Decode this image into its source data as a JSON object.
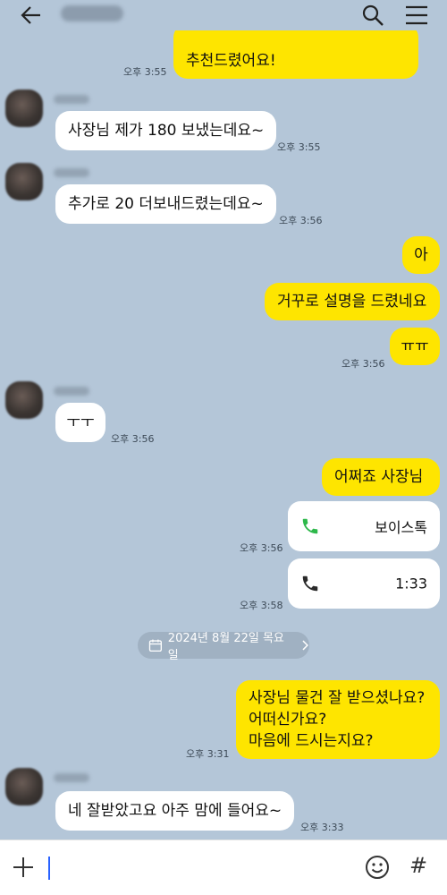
{
  "header": {
    "icons": [
      "back-arrow-icon",
      "search-icon",
      "hamburger-menu-icon"
    ]
  },
  "messages": [
    {
      "id": "m0",
      "dir": "out",
      "text": "추천드렸어요!",
      "time": "오후 3:55"
    },
    {
      "id": "m1",
      "dir": "in",
      "text": "사장님 제가 180 보냈는데요~",
      "time": "오후 3:55"
    },
    {
      "id": "m2",
      "dir": "in",
      "text": "추가로 20 더보내드렸는데요~",
      "time": "오후 3:56"
    },
    {
      "id": "m3",
      "dir": "out",
      "text": "아"
    },
    {
      "id": "m4",
      "dir": "out",
      "text": "거꾸로 설명을 드렸네요"
    },
    {
      "id": "m5",
      "dir": "out",
      "text": "ㅠㅠ",
      "time": "오후 3:56"
    },
    {
      "id": "m6",
      "dir": "in",
      "text": "ㅜㅜ",
      "time": "오후 3:56"
    },
    {
      "id": "m7",
      "dir": "out",
      "text": "어쩌죠 사장님"
    },
    {
      "id": "m8",
      "dir": "out",
      "type": "call",
      "icon": "phone-icon-green",
      "label": "보이스톡",
      "time": "오후 3:56"
    },
    {
      "id": "m9",
      "dir": "out",
      "type": "call",
      "icon": "phone-icon-dark",
      "label": "1:33",
      "time": "오후 3:58"
    },
    {
      "id": "m10",
      "dir": "out",
      "lines": [
        "사장님 물건 잘 받으셨나요?",
        "어떠신가요?",
        "마음에 드시는지요?"
      ],
      "time": "오후 3:31"
    },
    {
      "id": "m11",
      "dir": "in",
      "text": "네 잘받았고요  아주 맘에 들어요~",
      "time": "오후 3:33"
    }
  ],
  "date_divider": "2024년 8월 22일 목요일",
  "input": {
    "icons": [
      "plus-icon",
      "emoji-icon",
      "hashtag-icon"
    ],
    "hash_glyph": "#"
  },
  "colors": {
    "background": "#b4c6d8",
    "outgoing_bubble": "#fee500",
    "incoming_bubble": "#ffffff",
    "call_green": "#2eb84b"
  }
}
